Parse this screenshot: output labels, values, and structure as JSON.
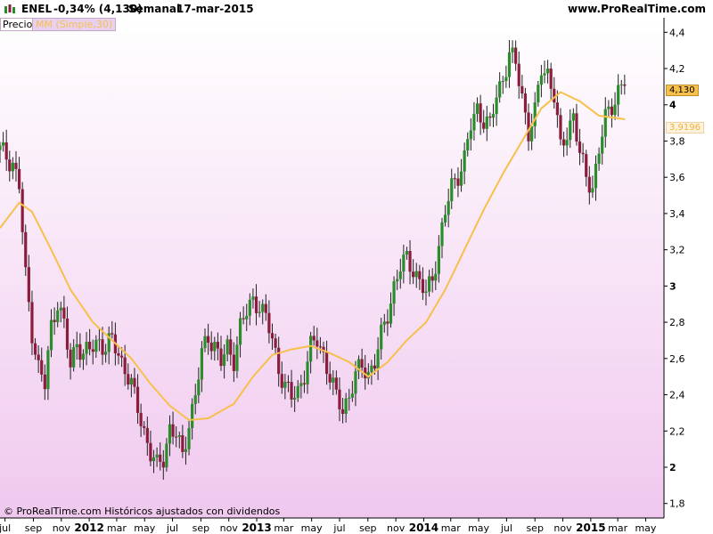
{
  "header": {
    "ticker": "ENEL",
    "change": "-0,34% (4,130)",
    "period": "Semanal",
    "date": "17-mar-2015",
    "site": "www.ProRealTime.com"
  },
  "legend": {
    "price_label": "Precio",
    "ma_label": "MM (Simple,30)"
  },
  "footer_note": "© ProRealTime.com  Históricos ajustados con dividendos",
  "chart_data": {
    "type": "line",
    "xlabel": "",
    "ylabel": "",
    "ylim": [
      1.72,
      4.48
    ],
    "yticks": [
      "4,4",
      "4,2",
      "4",
      "3,8",
      "3,6",
      "3,4",
      "3,2",
      "3",
      "2,8",
      "2,6",
      "2,4",
      "2,2",
      "2",
      "1,8"
    ],
    "ytick_values": [
      4.4,
      4.2,
      4.0,
      3.8,
      3.6,
      3.4,
      3.2,
      3.0,
      2.8,
      2.6,
      2.4,
      2.2,
      2.0,
      1.8
    ],
    "bold_yticks": [
      "4",
      "3",
      "2"
    ],
    "x_ticks": [
      "jul",
      "sep",
      "nov",
      "2012",
      "mar",
      "may",
      "jul",
      "sep",
      "nov",
      "2013",
      "mar",
      "may",
      "jul",
      "sep",
      "nov",
      "2014",
      "mar",
      "may",
      "jul",
      "sep",
      "nov",
      "2015",
      "mar",
      "may"
    ],
    "bold_x_ticks": [
      "2012",
      "2013",
      "2014",
      "2015"
    ],
    "x_start": "2011-06-20",
    "x_end": "2015-06-10",
    "last_price_label": "4,130",
    "ma_value_label": "3,9196",
    "price": [
      [
        "2011-06-20",
        3.75
      ],
      [
        "2011-07-18",
        3.68
      ],
      [
        "2011-08-01",
        3.55
      ],
      [
        "2011-08-15",
        3.05
      ],
      [
        "2011-08-29",
        2.75
      ],
      [
        "2011-09-12",
        2.55
      ],
      [
        "2011-09-26",
        2.45
      ],
      [
        "2011-10-10",
        2.78
      ],
      [
        "2011-10-24",
        2.92
      ],
      [
        "2011-11-07",
        2.78
      ],
      [
        "2011-11-21",
        2.55
      ],
      [
        "2011-12-05",
        2.7
      ],
      [
        "2011-12-19",
        2.62
      ],
      [
        "2012-01-09",
        2.66
      ],
      [
        "2012-01-23",
        2.7
      ],
      [
        "2012-02-06",
        2.66
      ],
      [
        "2012-02-20",
        2.7
      ],
      [
        "2012-03-05",
        2.62
      ],
      [
        "2012-03-19",
        2.55
      ],
      [
        "2012-04-02",
        2.45
      ],
      [
        "2012-04-16",
        2.32
      ],
      [
        "2012-04-30",
        2.2
      ],
      [
        "2012-05-14",
        2.08
      ],
      [
        "2012-05-28",
        2.0
      ],
      [
        "2012-06-11",
        2.05
      ],
      [
        "2012-06-25",
        2.22
      ],
      [
        "2012-07-09",
        2.18
      ],
      [
        "2012-07-23",
        2.05
      ],
      [
        "2012-08-06",
        2.25
      ],
      [
        "2012-08-20",
        2.4
      ],
      [
        "2012-09-03",
        2.62
      ],
      [
        "2012-09-17",
        2.72
      ],
      [
        "2012-10-01",
        2.68
      ],
      [
        "2012-10-15",
        2.58
      ],
      [
        "2012-10-29",
        2.65
      ],
      [
        "2012-11-12",
        2.6
      ],
      [
        "2012-11-26",
        2.78
      ],
      [
        "2012-12-10",
        2.85
      ],
      [
        "2012-12-24",
        2.92
      ],
      [
        "2013-01-07",
        2.9
      ],
      [
        "2013-01-21",
        2.82
      ],
      [
        "2013-02-04",
        2.7
      ],
      [
        "2013-02-18",
        2.55
      ],
      [
        "2013-03-04",
        2.45
      ],
      [
        "2013-03-18",
        2.38
      ],
      [
        "2013-04-01",
        2.42
      ],
      [
        "2013-04-15",
        2.52
      ],
      [
        "2013-04-29",
        2.66
      ],
      [
        "2013-05-13",
        2.7
      ],
      [
        "2013-05-27",
        2.62
      ],
      [
        "2013-06-10",
        2.5
      ],
      [
        "2013-06-24",
        2.38
      ],
      [
        "2013-07-08",
        2.32
      ],
      [
        "2013-07-22",
        2.4
      ],
      [
        "2013-08-05",
        2.5
      ],
      [
        "2013-08-19",
        2.56
      ],
      [
        "2013-09-02",
        2.52
      ],
      [
        "2013-09-16",
        2.58
      ],
      [
        "2013-09-30",
        2.72
      ],
      [
        "2013-10-14",
        2.85
      ],
      [
        "2013-10-28",
        3.0
      ],
      [
        "2013-11-11",
        3.1
      ],
      [
        "2013-11-25",
        3.15
      ],
      [
        "2013-12-09",
        3.1
      ],
      [
        "2013-12-23",
        3.02
      ],
      [
        "2014-01-06",
        2.95
      ],
      [
        "2014-01-20",
        3.05
      ],
      [
        "2014-02-03",
        3.22
      ],
      [
        "2014-02-17",
        3.4
      ],
      [
        "2014-03-03",
        3.55
      ],
      [
        "2014-03-17",
        3.62
      ],
      [
        "2014-03-31",
        3.7
      ],
      [
        "2014-04-14",
        3.88
      ],
      [
        "2014-04-28",
        3.98
      ],
      [
        "2014-05-12",
        3.92
      ],
      [
        "2014-05-26",
        3.88
      ],
      [
        "2014-06-09",
        4.05
      ],
      [
        "2014-06-23",
        4.15
      ],
      [
        "2014-07-07",
        4.28
      ],
      [
        "2014-07-21",
        4.22
      ],
      [
        "2014-08-04",
        4.05
      ],
      [
        "2014-08-18",
        3.85
      ],
      [
        "2014-09-01",
        3.95
      ],
      [
        "2014-09-15",
        4.2
      ],
      [
        "2014-09-29",
        4.18
      ],
      [
        "2014-10-13",
        4.05
      ],
      [
        "2014-10-27",
        3.75
      ],
      [
        "2014-11-10",
        3.85
      ],
      [
        "2014-11-24",
        3.95
      ],
      [
        "2014-12-08",
        3.72
      ],
      [
        "2014-12-22",
        3.6
      ],
      [
        "2015-01-05",
        3.55
      ],
      [
        "2015-01-19",
        3.75
      ],
      [
        "2015-02-02",
        3.92
      ],
      [
        "2015-02-16",
        4.0
      ],
      [
        "2015-03-02",
        4.08
      ],
      [
        "2015-03-17",
        4.13
      ]
    ],
    "ma_series": {
      "name": "MM (Simple,30)",
      "color": "#f7c04a",
      "points": [
        [
          "2011-06-20",
          3.32
        ],
        [
          "2011-08-01",
          3.46
        ],
        [
          "2011-08-29",
          3.41
        ],
        [
          "2011-10-10",
          3.2
        ],
        [
          "2011-11-21",
          2.98
        ],
        [
          "2012-01-09",
          2.8
        ],
        [
          "2012-02-20",
          2.7
        ],
        [
          "2012-04-02",
          2.6
        ],
        [
          "2012-05-14",
          2.46
        ],
        [
          "2012-06-25",
          2.34
        ],
        [
          "2012-08-06",
          2.26
        ],
        [
          "2012-09-17",
          2.27
        ],
        [
          "2012-11-12",
          2.35
        ],
        [
          "2012-12-24",
          2.5
        ],
        [
          "2013-02-04",
          2.62
        ],
        [
          "2013-03-18",
          2.65
        ],
        [
          "2013-04-29",
          2.67
        ],
        [
          "2013-06-10",
          2.63
        ],
        [
          "2013-07-22",
          2.58
        ],
        [
          "2013-09-02",
          2.5
        ],
        [
          "2013-10-14",
          2.58
        ],
        [
          "2013-11-25",
          2.7
        ],
        [
          "2014-01-06",
          2.8
        ],
        [
          "2014-02-17",
          2.98
        ],
        [
          "2014-03-31",
          3.2
        ],
        [
          "2014-05-12",
          3.42
        ],
        [
          "2014-06-23",
          3.62
        ],
        [
          "2014-08-04",
          3.8
        ],
        [
          "2014-09-15",
          3.98
        ],
        [
          "2014-10-27",
          4.07
        ],
        [
          "2014-12-08",
          4.02
        ],
        [
          "2015-01-19",
          3.94
        ],
        [
          "2015-03-17",
          3.92
        ]
      ]
    }
  },
  "colors": {
    "up": "#2a8c2a",
    "down": "#8b1c3c",
    "ma": "#f7c04a",
    "bg_top": "#ffffff",
    "bg_bottom": "#f0c8ee"
  }
}
